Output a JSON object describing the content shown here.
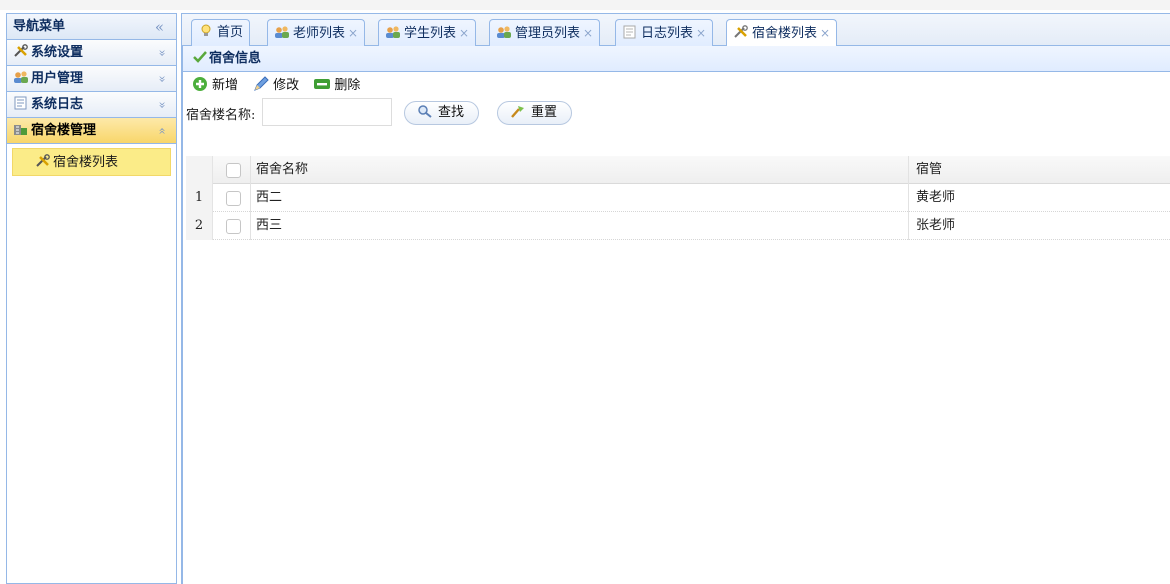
{
  "sidebar": {
    "title": "导航菜单",
    "collapse_glyph": "«",
    "sections": [
      {
        "label": "系统设置",
        "icon": "tools-icon",
        "tool": "»",
        "active": false
      },
      {
        "label": "用户管理",
        "icon": "users-icon",
        "tool": "»",
        "active": false
      },
      {
        "label": "系统日志",
        "icon": "log-icon",
        "tool": "»",
        "active": false
      },
      {
        "label": "宿舍楼管理",
        "icon": "building-icon",
        "tool": "«",
        "active": true
      }
    ],
    "items": [
      {
        "label": "宿舍楼列表",
        "icon": "tools-icon"
      }
    ]
  },
  "tabs": [
    {
      "label": "首页",
      "icon": "bulb-icon",
      "closable": false
    },
    {
      "label": "老师列表",
      "icon": "users-icon",
      "closable": true
    },
    {
      "label": "学生列表",
      "icon": "users-icon",
      "closable": true
    },
    {
      "label": "管理员列表",
      "icon": "users-icon",
      "closable": true
    },
    {
      "label": "日志列表",
      "icon": "doc-icon",
      "closable": true
    },
    {
      "label": "宿舍楼列表",
      "icon": "tools-icon",
      "closable": true,
      "selected": true
    }
  ],
  "close_glyph": "×",
  "panel": {
    "title": "宿舍信息",
    "toolbar": {
      "add": "新增",
      "edit": "修改",
      "delete": "删除"
    },
    "search": {
      "label": "宿舍楼名称:",
      "value": "",
      "find": "查找",
      "reset": "重置"
    }
  },
  "grid": {
    "columns": {
      "name": "宿舍名称",
      "manager": "宿管"
    },
    "rows": [
      {
        "num": "1",
        "name": "西二",
        "manager": "黄老师"
      },
      {
        "num": "2",
        "name": "西三",
        "manager": "张老师"
      }
    ]
  },
  "colors": {
    "border": "#95b8e7",
    "active_header": "#f8d66a",
    "nav_item": "#fbec88",
    "header_text": "#0e2d5f"
  }
}
